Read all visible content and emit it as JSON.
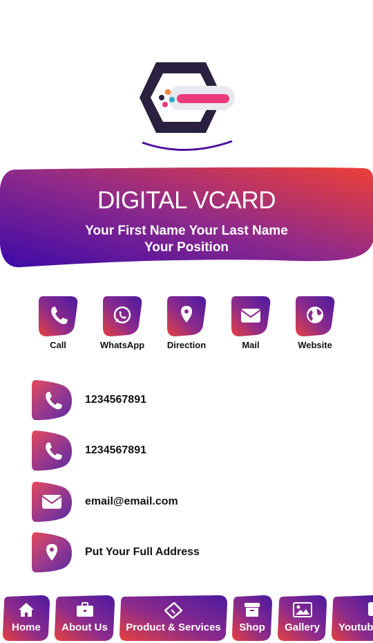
{
  "header": {
    "title": "DIGITAL VCARD",
    "name": "Your First Name Your Last Name",
    "position": "Your Position"
  },
  "colors": {
    "gradient_start": "#3d0aa8",
    "gradient_mid": "#8f2a8a",
    "gradient_end": "#ee4036",
    "logo_dark": "#2a2140",
    "logo_pink": "#ec3a7d"
  },
  "quick_actions": [
    {
      "label": "Call",
      "icon": "phone-icon"
    },
    {
      "label": "WhatsApp",
      "icon": "whatsapp-icon"
    },
    {
      "label": "Direction",
      "icon": "map-pin-icon"
    },
    {
      "label": "Mail",
      "icon": "envelope-icon"
    },
    {
      "label": "Website",
      "icon": "globe-icon"
    }
  ],
  "contacts": [
    {
      "value": "1234567891",
      "icon": "phone-icon"
    },
    {
      "value": "1234567891",
      "icon": "phone-icon"
    },
    {
      "value": "email@email.com",
      "icon": "envelope-icon"
    },
    {
      "value": "Put Your Full Address",
      "icon": "map-pin-icon"
    }
  ],
  "bottom_nav": [
    {
      "label": "Home",
      "icon": "home-icon"
    },
    {
      "label": "About Us",
      "icon": "briefcase-icon"
    },
    {
      "label": "Product & Services",
      "icon": "ticket-icon"
    },
    {
      "label": "Shop",
      "icon": "archive-box-icon"
    },
    {
      "label": "Gallery",
      "icon": "image-icon"
    },
    {
      "label": "Youtube",
      "icon": "youtube-icon"
    }
  ]
}
